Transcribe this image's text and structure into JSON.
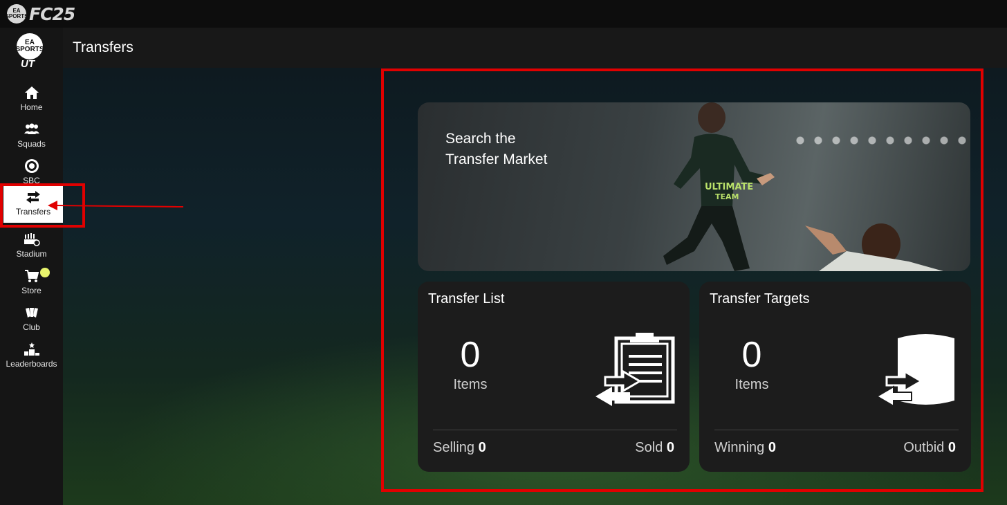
{
  "app": {
    "ea_badge": "EA SPORTS",
    "brand": "FC25",
    "ut_badge": "EA SPORTS",
    "ut_text": "UT"
  },
  "header": {
    "title": "Transfers"
  },
  "sidebar": {
    "items": [
      {
        "label": "Home",
        "icon": "home-icon"
      },
      {
        "label": "Squads",
        "icon": "squads-icon"
      },
      {
        "label": "SBC",
        "icon": "sbc-icon"
      },
      {
        "label": "Transfers",
        "icon": "transfers-icon",
        "active": true
      },
      {
        "label": "Stadium",
        "icon": "stadium-icon"
      },
      {
        "label": "Store",
        "icon": "store-icon",
        "notification": true
      },
      {
        "label": "Club",
        "icon": "club-icon"
      },
      {
        "label": "Leaderboards",
        "icon": "leaderboards-icon"
      }
    ]
  },
  "search_market": {
    "title": "Search the\nTransfer Market"
  },
  "transfer_list": {
    "title": "Transfer List",
    "count": "0",
    "count_label": "Items",
    "left_label": "Selling",
    "left_value": "0",
    "right_label": "Sold",
    "right_value": "0"
  },
  "transfer_targets": {
    "title": "Transfer Targets",
    "count": "0",
    "count_label": "Items",
    "left_label": "Winning",
    "left_value": "0",
    "right_label": "Outbid",
    "right_value": "0"
  },
  "colors": {
    "annotation_red": "#e00000",
    "store_notification": "#e9f56d",
    "card_bg": "#1c1c1c"
  }
}
